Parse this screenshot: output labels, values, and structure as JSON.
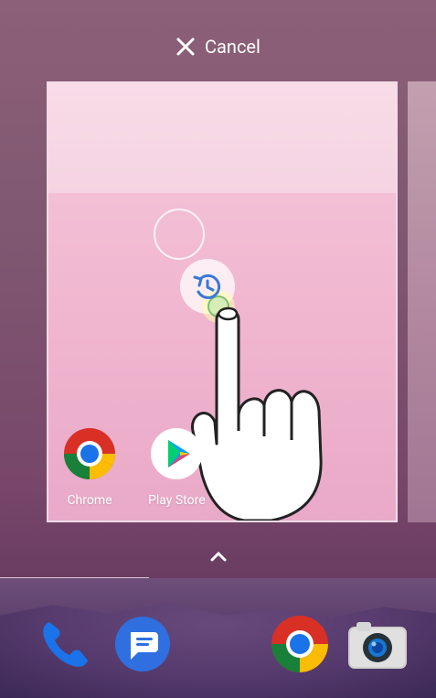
{
  "top": {
    "cancel_label": "Cancel"
  },
  "card": {
    "apps": [
      {
        "label": "Chrome"
      },
      {
        "label": "Play Store"
      }
    ]
  },
  "dock": {
    "items": [
      {
        "name": "phone"
      },
      {
        "name": "messages"
      },
      {
        "name": "chrome"
      },
      {
        "name": "camera"
      }
    ]
  },
  "colors": {
    "card_border": "#f3dce7",
    "card_bg": "#f1b7d0",
    "dock_bg": "#5a3c6b",
    "phone_blue": "#1a73e8",
    "messages_blue": "#2f6fe0",
    "chrome_red": "#d93025",
    "chrome_yellow": "#fbbc04",
    "chrome_green": "#188038",
    "camera_gray": "#e0e0e0"
  }
}
